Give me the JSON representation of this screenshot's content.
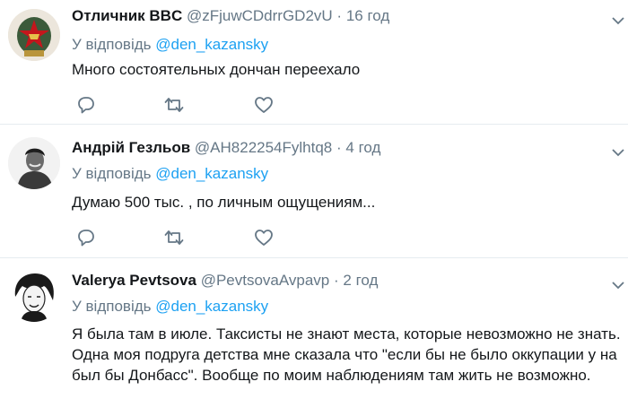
{
  "tweets": [
    {
      "name": "Отличник BBC",
      "handle": "@zFjuwCDdrrGD2vU",
      "dot": "·",
      "time": "16 год",
      "reply_prefix": "У відповідь",
      "reply_to": "@den_kazansky",
      "lines": [
        "Много состоятельных дончан переехало"
      ],
      "avatar": "star-badge-avatar"
    },
    {
      "name": "Андрій Гезльов",
      "handle": "@AH822254Fylhtq8",
      "dot": "·",
      "time": "4 год",
      "reply_prefix": "У відповідь",
      "reply_to": "@den_kazansky",
      "lines": [
        "Думаю 500 тыс. , по личным ощущениям..."
      ],
      "avatar": "person-photo-avatar"
    },
    {
      "name": "Valerya Pevtsova",
      "handle": "@PevtsovaAvpavp",
      "dot": "·",
      "time": "2 год",
      "reply_prefix": "У відповідь",
      "reply_to": "@den_kazansky",
      "lines": [
        "Я была там в июле. Таксисты не знают места, которые невозможно не знать.",
        "Одна моя подруга детства мне сказала что \"если бы не было оккупации у на",
        "был бы Донбасс\".  Вообще по моим наблюдениям там жить не возможно."
      ],
      "avatar": "woman-portrait-avatar"
    }
  ],
  "icons": {
    "reply": "reply-icon",
    "retweet": "retweet-icon",
    "like": "heart-icon",
    "more": "chevron-down-icon"
  },
  "colors": {
    "link": "#1da1f2",
    "muted": "#657786",
    "text": "#14171a",
    "divider": "#e6ecf0"
  }
}
